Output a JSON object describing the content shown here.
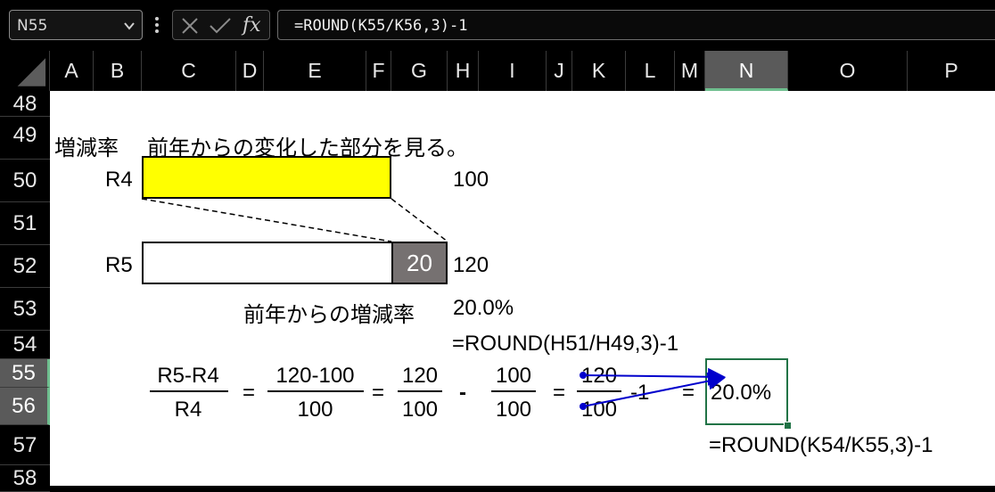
{
  "formula_bar": {
    "name_box": "N55",
    "fx": "fx",
    "formula": "=ROUND(K55/K56,3)-1"
  },
  "columns": [
    "A",
    "B",
    "C",
    "D",
    "E",
    "F",
    "G",
    "H",
    "I",
    "J",
    "K",
    "L",
    "M",
    "N",
    "O",
    "P"
  ],
  "selected_column": "N",
  "rows": [
    "48",
    "49",
    "50",
    "51",
    "52",
    "53",
    "54",
    "55",
    "56",
    "57",
    "58"
  ],
  "selected_rows": [
    "55",
    "56"
  ],
  "cells": {
    "heading_label": "増減率",
    "heading_desc": "前年からの変化した部分を見る。",
    "r4_label": "R4",
    "r4_value": "100",
    "r5_label": "R5",
    "r5_value": "120",
    "diff_value": "20",
    "rate_label": "前年からの増減率",
    "rate_value": "20.0%",
    "rate_formula": "=ROUND(H51/H49,3)-1",
    "frac1_num": "R5-R4",
    "frac1_den": "R4",
    "eq1": "=",
    "frac2_num": "120-100",
    "frac2_den": "100",
    "eq2": "=",
    "frac3_num": "120",
    "frac3_den": "100",
    "minus": "-",
    "frac4_num": "100",
    "frac4_den": "100",
    "eq3": "=",
    "frac5_num": "120",
    "frac5_den": "100",
    "minus_one": "-1",
    "eq4": "=",
    "result_value": "20.0%",
    "result_formula": "=ROUND(K54/K55,3)-1"
  },
  "colors": {
    "r4_fill": "#ffff00",
    "diff_fill": "#767171",
    "arrow": "#0000cc",
    "selection": "#217346"
  }
}
